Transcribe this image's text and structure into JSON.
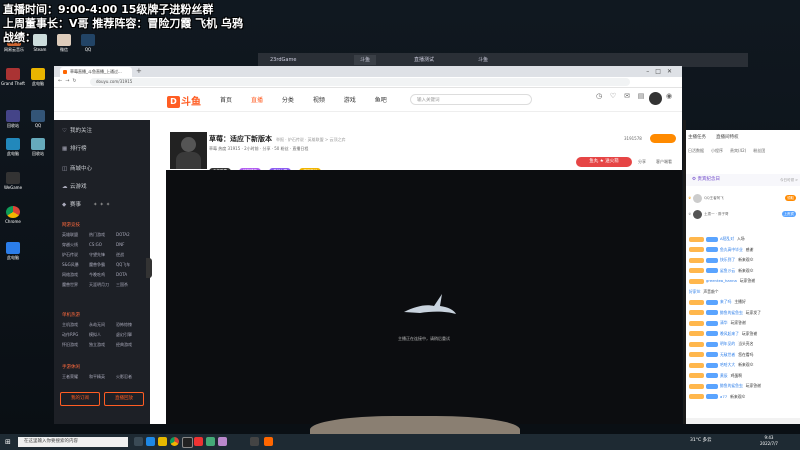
{
  "overlay": {
    "line1": "直播时间：9:00-4:00 15级牌子进粉丝群",
    "line2": "上周董事长：V哥 推荐阵容：冒险刀霞 飞机 乌鸦",
    "line3": "战绩："
  },
  "back_window": {
    "tabs": [
      "23rdGame",
      "斗鱼",
      "直播测试",
      "斗鱼"
    ]
  },
  "browser": {
    "tab_title": "草莓直播_斗鱼直播_上通过...",
    "url": "douyu.com/31915"
  },
  "site": {
    "logo_text": "斗鱼",
    "nav": [
      "首页",
      "直播",
      "分类",
      "视频",
      "游戏",
      "鱼吧"
    ],
    "active_nav": "直播",
    "search_placeholder": "输入关键词",
    "header_icons": [
      {
        "icon": "history-icon",
        "label": "历史"
      },
      {
        "icon": "follow-icon",
        "label": "关注"
      },
      {
        "icon": "msg-icon",
        "label": "消息"
      },
      {
        "icon": "task-icon",
        "label": "任务"
      },
      {
        "icon": "download-icon",
        "label": "下载"
      },
      {
        "icon": "live-icon",
        "label": "开播"
      }
    ]
  },
  "sidebar": {
    "items": [
      {
        "icon": "heart-icon",
        "label": "我的关注"
      },
      {
        "icon": "rank-icon",
        "label": "排行榜"
      },
      {
        "icon": "shop-icon",
        "label": "商城中心"
      },
      {
        "icon": "cloud-icon",
        "label": "云游戏"
      },
      {
        "icon": "event-icon",
        "label": "赛事"
      }
    ],
    "section1_title": "网游竞技",
    "section1_games": [
      "英雄联盟",
      "热门游戏",
      "DOTA2",
      "穿越火线",
      "CS:GO",
      "DNF",
      "炉石传说",
      "守望先锋",
      "逆战",
      "S&G风暴",
      "魔兽争霸",
      "QQ飞车",
      "网络游戏",
      "今晚吃鸡",
      "DOTA",
      "魔兽世界",
      "天涯明月刀",
      "三国杀"
    ],
    "section2_title": "单机热游",
    "section2_games": [
      "主机游戏",
      "永劫无间",
      "恐怖惊悚",
      "动作RPG",
      "模拟人",
      "虚幻引擎",
      "怀旧游戏",
      "独立游戏",
      "经典游戏"
    ],
    "section3_title": "手游休闲",
    "section3_games": [
      "王者荣耀",
      "和平精英",
      "火影忍者"
    ],
    "btn_left": "我的订阅",
    "btn_right": "直播回放"
  },
  "room": {
    "title": "草莓：适应下新版本",
    "title_sub": "举报 · 炉石传说 · 英雄联盟 > 云顶之弈",
    "meta": "草莓  热度 31915  · 2小时前 · 分享 · 50 粉丝 · 直播日程",
    "badges": [
      "主播勋章",
      "捕获猎场",
      "奇幻大赛",
      "超级粉丝"
    ],
    "room_id": "3191578",
    "fan_button": "鱼丸 ★ 送火箭",
    "actions": [
      "分享",
      "客户端看"
    ]
  },
  "video": {
    "loading": "主播正在连接中，请稍后重试"
  },
  "chat": {
    "tabs": [
      "主播任务",
      "直播间特权"
    ],
    "subtabs": [
      "日活数据",
      "小程序",
      "贵宾(42)",
      "粉丝团"
    ],
    "banner": "贵宾纪念日",
    "banner_right": "今日可领 >",
    "top_users": [
      {
        "name": "QQ王者阿飞",
        "btn": "领取"
      },
      {
        "name": "土拨一 · 胖子哥",
        "btn": "上贵宾"
      }
    ],
    "messages": [
      {
        "name": "A陌乱对",
        "text": "入场"
      },
      {
        "name": "鱼丸高中毕业",
        "text": "感谢"
      },
      {
        "name": "快乐到了",
        "text": "新来观众"
      },
      {
        "name": "鲨鱼沙云",
        "text": "新来观众"
      },
      {
        "name": "greentea_hanna",
        "text": "玩家答谢"
      },
      {
        "name": "好家伙",
        "text": "声音敲个"
      },
      {
        "name": "来了吗",
        "text": "主播好"
      },
      {
        "name": "鲸鱼的鲨鱼虫",
        "text": "玩家发了"
      },
      {
        "name": "清华",
        "text": "玩家答谢"
      },
      {
        "name": "晚风起来了",
        "text": "玩家答谢"
      },
      {
        "name": "明年见的",
        "text": "当头亮名"
      },
      {
        "name": "无敌世者",
        "text": "您在看吗"
      },
      {
        "name": "哈哈大大",
        "text": "新来观众"
      },
      {
        "name": "黄辰",
        "text": "鸡蛋啊"
      },
      {
        "name": "鲸鱼的鲨鱼虫",
        "text": "玩家答谢"
      },
      {
        "name": "a77",
        "text": "新来观众"
      }
    ]
  },
  "taskbar": {
    "search_placeholder": "在这里输入你要搜索的内容",
    "weather": "31°C 多云",
    "time": "9:43",
    "date": "2022/7/7"
  },
  "desktop": {
    "icons": [
      "网易云音乐",
      "Steam",
      "微信",
      "QQ",
      "此电脑",
      "回收站",
      "Grand Theft",
      "Chrome",
      "WeGame"
    ]
  }
}
